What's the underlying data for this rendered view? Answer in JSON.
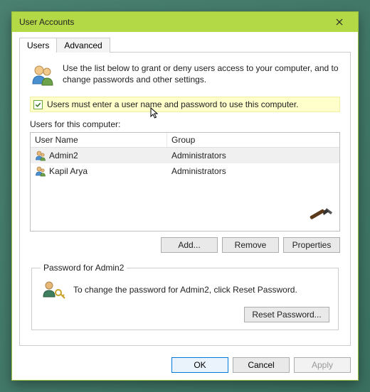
{
  "window": {
    "title": "User Accounts"
  },
  "tabs": {
    "users": "Users",
    "advanced": "Advanced"
  },
  "intro": {
    "text": "Use the list below to grant or deny users access to your computer, and to change passwords and other settings."
  },
  "checkbox": {
    "label": "Users must enter a user name and password to use this computer.",
    "checked": true
  },
  "list": {
    "caption": "Users for this computer:",
    "col1": "User Name",
    "col2": "Group",
    "rows": [
      {
        "name": "Admin2",
        "group": "Administrators",
        "selected": true
      },
      {
        "name": "Kapil Arya",
        "group": "Administrators",
        "selected": false
      }
    ]
  },
  "buttons": {
    "add": "Add...",
    "remove": "Remove",
    "properties": "Properties",
    "reset": "Reset Password...",
    "ok": "OK",
    "cancel": "Cancel",
    "apply": "Apply"
  },
  "password_group": {
    "legend": "Password for Admin2",
    "text": "To change the password for Admin2, click Reset Password."
  }
}
